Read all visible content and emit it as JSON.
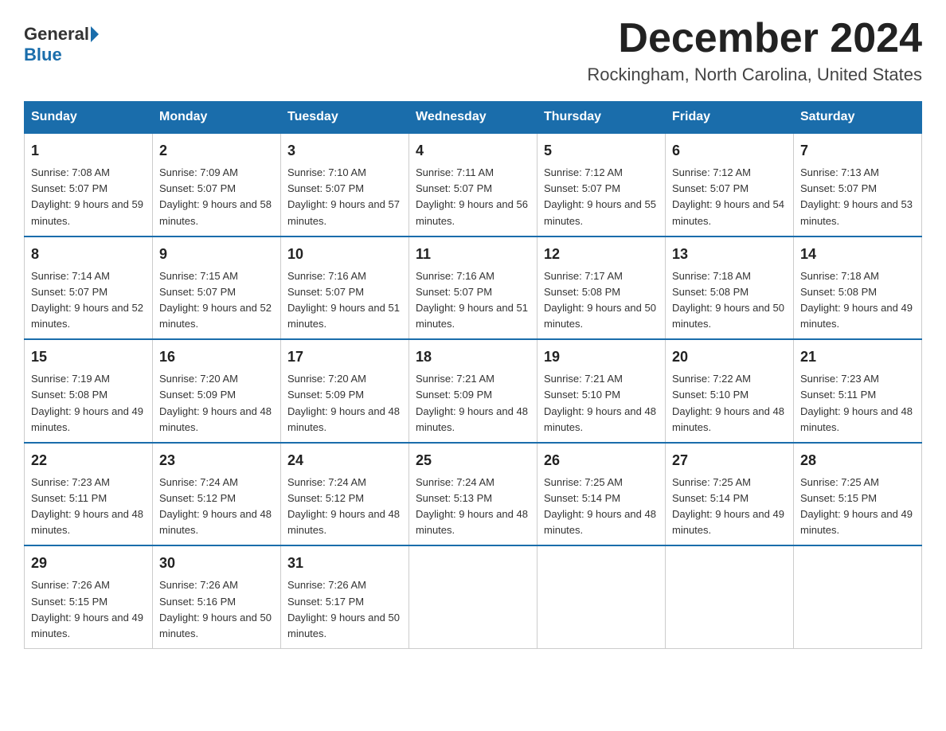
{
  "logo": {
    "general": "General",
    "blue": "Blue"
  },
  "title": "December 2024",
  "location": "Rockingham, North Carolina, United States",
  "days_of_week": [
    "Sunday",
    "Monday",
    "Tuesday",
    "Wednesday",
    "Thursday",
    "Friday",
    "Saturday"
  ],
  "weeks": [
    [
      {
        "day": "1",
        "sunrise": "7:08 AM",
        "sunset": "5:07 PM",
        "daylight": "9 hours and 59 minutes."
      },
      {
        "day": "2",
        "sunrise": "7:09 AM",
        "sunset": "5:07 PM",
        "daylight": "9 hours and 58 minutes."
      },
      {
        "day": "3",
        "sunrise": "7:10 AM",
        "sunset": "5:07 PM",
        "daylight": "9 hours and 57 minutes."
      },
      {
        "day": "4",
        "sunrise": "7:11 AM",
        "sunset": "5:07 PM",
        "daylight": "9 hours and 56 minutes."
      },
      {
        "day": "5",
        "sunrise": "7:12 AM",
        "sunset": "5:07 PM",
        "daylight": "9 hours and 55 minutes."
      },
      {
        "day": "6",
        "sunrise": "7:12 AM",
        "sunset": "5:07 PM",
        "daylight": "9 hours and 54 minutes."
      },
      {
        "day": "7",
        "sunrise": "7:13 AM",
        "sunset": "5:07 PM",
        "daylight": "9 hours and 53 minutes."
      }
    ],
    [
      {
        "day": "8",
        "sunrise": "7:14 AM",
        "sunset": "5:07 PM",
        "daylight": "9 hours and 52 minutes."
      },
      {
        "day": "9",
        "sunrise": "7:15 AM",
        "sunset": "5:07 PM",
        "daylight": "9 hours and 52 minutes."
      },
      {
        "day": "10",
        "sunrise": "7:16 AM",
        "sunset": "5:07 PM",
        "daylight": "9 hours and 51 minutes."
      },
      {
        "day": "11",
        "sunrise": "7:16 AM",
        "sunset": "5:07 PM",
        "daylight": "9 hours and 51 minutes."
      },
      {
        "day": "12",
        "sunrise": "7:17 AM",
        "sunset": "5:08 PM",
        "daylight": "9 hours and 50 minutes."
      },
      {
        "day": "13",
        "sunrise": "7:18 AM",
        "sunset": "5:08 PM",
        "daylight": "9 hours and 50 minutes."
      },
      {
        "day": "14",
        "sunrise": "7:18 AM",
        "sunset": "5:08 PM",
        "daylight": "9 hours and 49 minutes."
      }
    ],
    [
      {
        "day": "15",
        "sunrise": "7:19 AM",
        "sunset": "5:08 PM",
        "daylight": "9 hours and 49 minutes."
      },
      {
        "day": "16",
        "sunrise": "7:20 AM",
        "sunset": "5:09 PM",
        "daylight": "9 hours and 48 minutes."
      },
      {
        "day": "17",
        "sunrise": "7:20 AM",
        "sunset": "5:09 PM",
        "daylight": "9 hours and 48 minutes."
      },
      {
        "day": "18",
        "sunrise": "7:21 AM",
        "sunset": "5:09 PM",
        "daylight": "9 hours and 48 minutes."
      },
      {
        "day": "19",
        "sunrise": "7:21 AM",
        "sunset": "5:10 PM",
        "daylight": "9 hours and 48 minutes."
      },
      {
        "day": "20",
        "sunrise": "7:22 AM",
        "sunset": "5:10 PM",
        "daylight": "9 hours and 48 minutes."
      },
      {
        "day": "21",
        "sunrise": "7:23 AM",
        "sunset": "5:11 PM",
        "daylight": "9 hours and 48 minutes."
      }
    ],
    [
      {
        "day": "22",
        "sunrise": "7:23 AM",
        "sunset": "5:11 PM",
        "daylight": "9 hours and 48 minutes."
      },
      {
        "day": "23",
        "sunrise": "7:24 AM",
        "sunset": "5:12 PM",
        "daylight": "9 hours and 48 minutes."
      },
      {
        "day": "24",
        "sunrise": "7:24 AM",
        "sunset": "5:12 PM",
        "daylight": "9 hours and 48 minutes."
      },
      {
        "day": "25",
        "sunrise": "7:24 AM",
        "sunset": "5:13 PM",
        "daylight": "9 hours and 48 minutes."
      },
      {
        "day": "26",
        "sunrise": "7:25 AM",
        "sunset": "5:14 PM",
        "daylight": "9 hours and 48 minutes."
      },
      {
        "day": "27",
        "sunrise": "7:25 AM",
        "sunset": "5:14 PM",
        "daylight": "9 hours and 49 minutes."
      },
      {
        "day": "28",
        "sunrise": "7:25 AM",
        "sunset": "5:15 PM",
        "daylight": "9 hours and 49 minutes."
      }
    ],
    [
      {
        "day": "29",
        "sunrise": "7:26 AM",
        "sunset": "5:15 PM",
        "daylight": "9 hours and 49 minutes."
      },
      {
        "day": "30",
        "sunrise": "7:26 AM",
        "sunset": "5:16 PM",
        "daylight": "9 hours and 50 minutes."
      },
      {
        "day": "31",
        "sunrise": "7:26 AM",
        "sunset": "5:17 PM",
        "daylight": "9 hours and 50 minutes."
      },
      null,
      null,
      null,
      null
    ]
  ]
}
